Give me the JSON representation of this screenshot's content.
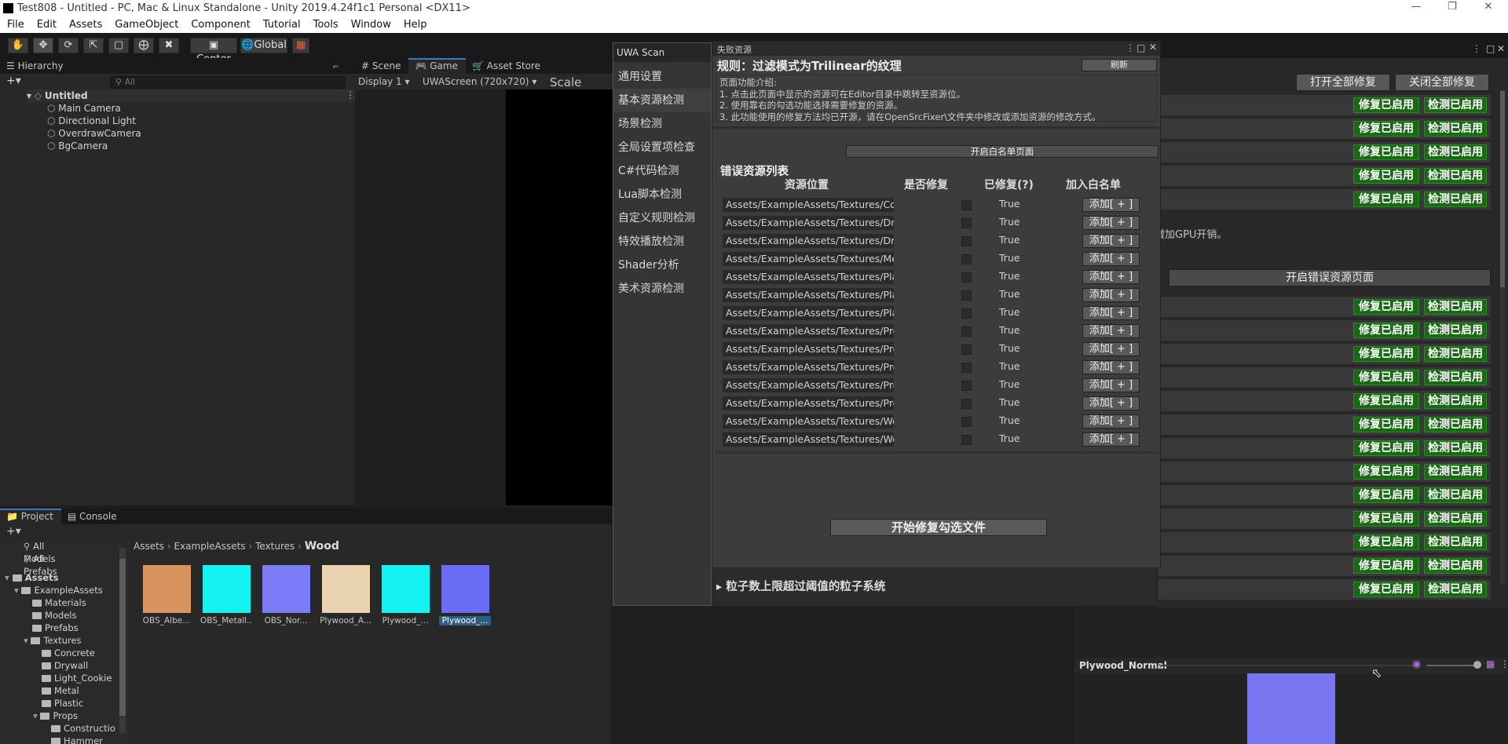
{
  "window": {
    "title": "Test808 - Untitled - PC, Mac & Linux Standalone - Unity 2019.4.24f1c1 Personal <DX11>"
  },
  "menu": [
    "File",
    "Edit",
    "Assets",
    "GameObject",
    "Component",
    "Tutorial",
    "Tools",
    "Window",
    "Help"
  ],
  "toolbar": {
    "center_label": "Center",
    "global_label": "Global"
  },
  "hierarchy": {
    "tab_label": "Hierarchy",
    "search_placeholder": "All",
    "scene_name": "Untitled",
    "items": [
      "Main Camera",
      "Directional Light",
      "OverdrawCamera",
      "BgCamera"
    ]
  },
  "scene_tabs": {
    "scene": "Scene",
    "game": "Game",
    "asset_store": "Asset Store"
  },
  "game_view": {
    "display": "Display 1",
    "resolution": "UWAScreen (720x720)",
    "scale_label": "Scale"
  },
  "project": {
    "tab_project": "Project",
    "tab_console": "Console",
    "favorites": [
      "All Models",
      "All Prefabs"
    ],
    "tree": [
      {
        "label": "Assets",
        "level": 0
      },
      {
        "label": "ExampleAssets",
        "level": 1
      },
      {
        "label": "Materials",
        "level": 2
      },
      {
        "label": "Models",
        "level": 2
      },
      {
        "label": "Prefabs",
        "level": 2
      },
      {
        "label": "Textures",
        "level": 2
      },
      {
        "label": "Concrete",
        "level": 3
      },
      {
        "label": "Drywall",
        "level": 3
      },
      {
        "label": "Light_Cookie",
        "level": 3
      },
      {
        "label": "Metal",
        "level": 3
      },
      {
        "label": "Plastic",
        "level": 3
      },
      {
        "label": "Props",
        "level": 3
      },
      {
        "label": "Constructio",
        "level": 4
      },
      {
        "label": "Hammer",
        "level": 4
      }
    ],
    "breadcrumb": [
      "Assets",
      "ExampleAssets",
      "Textures",
      "Wood"
    ],
    "thumbnails": [
      {
        "label": "OBS_Albe...",
        "color": "#d9935f"
      },
      {
        "label": "OBS_Metall...",
        "color": "#14f2f2"
      },
      {
        "label": "OBS_Nor...",
        "color": "#7d7cf8"
      },
      {
        "label": "Plywood_A...",
        "color": "#ead3b1"
      },
      {
        "label": "Plywood_...",
        "color": "#14f2f2"
      },
      {
        "label": "Plywood_...",
        "color": "#6a6cf5"
      }
    ]
  },
  "preview": {
    "title": "Plywood_Normal",
    "color": "#7775f0"
  },
  "right_panel": {
    "open_all": "打开全部修复",
    "close_all": "关闭全部修复",
    "fix_enabled": "修复已启用",
    "detect_enabled": "检测已启用",
    "gpu_note": "增加GPU开销。",
    "open_error_page": "开启错误资源页面",
    "partial_text": "粒子数上限超过阈值的粒子系统"
  },
  "uwa": {
    "tab": "UWA Scan",
    "nav": [
      "通用设置",
      "基本资源检测",
      "场景检测",
      "全局设置项检查",
      "C#代码检测",
      "Lua脚本检测",
      "自定义规则检测",
      "特效播放检测",
      "Shader分析",
      "美术资源检测"
    ],
    "selected_index": 1
  },
  "dialog": {
    "tab": "失败资源",
    "rule_title": "规则：过滤模式为Trilinear的纹理",
    "refresh": "刷新",
    "intro_title": "页面功能介绍:",
    "intro_lines": [
      "1. 点击此页面中显示的资源可在Editor目录中跳转至资源位。",
      "2. 使用靠右的勾选功能选择需要修复的资源。",
      "3. 此功能使用的修复方法均已开源，请在OpenSrcFixer\\文件夹中修改或添加资源的修改方式。"
    ],
    "whitelist_page": "开启白名单页面",
    "list_title": "错误资源列表",
    "columns": [
      "资源位置",
      "是否修复",
      "已修复(?)",
      "加入白名单"
    ],
    "rows": [
      {
        "path": "Assets/ExampleAssets/Textures/Co",
        "fixed": "True",
        "add": "添加[ + ]"
      },
      {
        "path": "Assets/ExampleAssets/Textures/Dry",
        "fixed": "True",
        "add": "添加[ + ]"
      },
      {
        "path": "Assets/ExampleAssets/Textures/Dry",
        "fixed": "True",
        "add": "添加[ + ]"
      },
      {
        "path": "Assets/ExampleAssets/Textures/Me",
        "fixed": "True",
        "add": "添加[ + ]"
      },
      {
        "path": "Assets/ExampleAssets/Textures/Pla",
        "fixed": "True",
        "add": "添加[ + ]"
      },
      {
        "path": "Assets/ExampleAssets/Textures/Pla",
        "fixed": "True",
        "add": "添加[ + ]"
      },
      {
        "path": "Assets/ExampleAssets/Textures/Pla",
        "fixed": "True",
        "add": "添加[ + ]"
      },
      {
        "path": "Assets/ExampleAssets/Textures/Pro",
        "fixed": "True",
        "add": "添加[ + ]"
      },
      {
        "path": "Assets/ExampleAssets/Textures/Pro",
        "fixed": "True",
        "add": "添加[ + ]"
      },
      {
        "path": "Assets/ExampleAssets/Textures/Pro",
        "fixed": "True",
        "add": "添加[ + ]"
      },
      {
        "path": "Assets/ExampleAssets/Textures/Pro",
        "fixed": "True",
        "add": "添加[ + ]"
      },
      {
        "path": "Assets/ExampleAssets/Textures/Pro",
        "fixed": "True",
        "add": "添加[ + ]"
      },
      {
        "path": "Assets/ExampleAssets/Textures/Wo",
        "fixed": "True",
        "add": "添加[ + ]"
      },
      {
        "path": "Assets/ExampleAssets/Textures/Wo",
        "fixed": "True",
        "add": "添加[ + ]"
      }
    ],
    "start_fix": "开始修复勾选文件"
  }
}
